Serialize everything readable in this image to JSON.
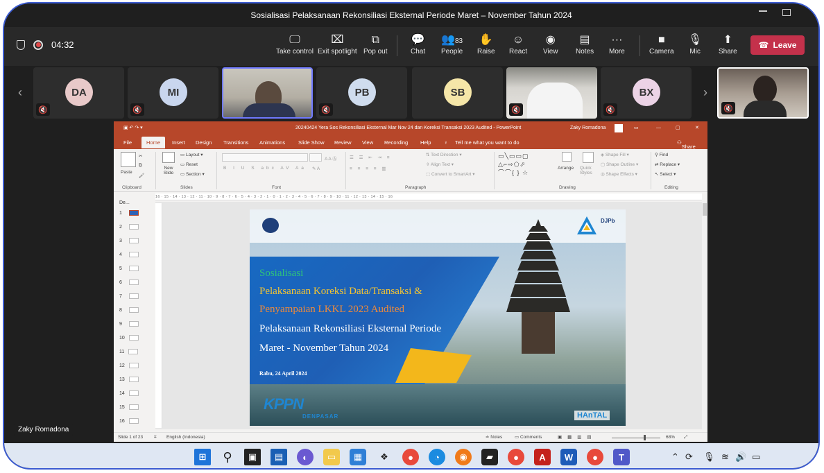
{
  "window": {
    "title": "Sosialisasi Pelaksanaan Rekonsiliasi Eksternal Periode Maret – November Tahun 2024"
  },
  "meeting": {
    "timer": "04:32",
    "people_count": "83"
  },
  "toolbar": {
    "take_control": "Take control",
    "exit_spotlight": "Exit spotlight",
    "pop_out": "Pop out",
    "chat": "Chat",
    "people": "People",
    "raise": "Raise",
    "react": "React",
    "view": "View",
    "notes": "Notes",
    "more": "More",
    "camera": "Camera",
    "mic": "Mic",
    "share": "Share",
    "leave": "Leave"
  },
  "participants": [
    {
      "initials": "DA",
      "color": "#e8c9c9"
    },
    {
      "initials": "MI",
      "color": "#c9d6ee"
    },
    {
      "initials": "",
      "color": ""
    },
    {
      "initials": "PB",
      "color": "#cfdcee"
    },
    {
      "initials": "SB",
      "color": "#f5e6a8"
    },
    {
      "initials": "",
      "color": ""
    },
    {
      "initials": "BX",
      "color": "#ecd3e6"
    }
  ],
  "ppt": {
    "title": "20240424 Yera Sos Rekonsiliasi Eksternal Mar Nov 24 dan Koreksi Transaksi 2023 Audited - PowerPoint",
    "user": "Zaky Romadona",
    "tabs": [
      "File",
      "Home",
      "Insert",
      "Design",
      "Transitions",
      "Animations",
      "Slide Show",
      "Review",
      "View",
      "Recording",
      "Help"
    ],
    "tell_me": "Tell me what you want to do",
    "share": "Share",
    "ribbon": {
      "paste": "Paste",
      "new_slide": "New Slide",
      "layout": "Layout",
      "reset": "Reset",
      "section": "Section",
      "text_direction": "Text Direction",
      "align_text": "Align Text",
      "convert_smartart": "Convert to SmartArt",
      "arrange": "Arrange",
      "quick_styles": "Quick Styles",
      "shape_fill": "Shape Fill",
      "shape_outline": "Shape Outline",
      "shape_effects": "Shape Effects",
      "find": "Find",
      "replace": "Replace",
      "select": "Select",
      "groups": [
        "Clipboard",
        "Slides",
        "Font",
        "Paragraph",
        "Drawing",
        "Editing"
      ]
    },
    "ruler": "16 · 15 · 14 · 13 · 12 · 11 · 10 · 9 · 8 · 7 · 6 · 5 · 4 · 3 · 2 · 1 · 0 · 1 · 2 · 3 · 4 · 5 · 6 · 7 · 8 · 9 · 10 · 11 · 12 · 13 · 14 · 15 · 16",
    "thumbs_label": "De...",
    "slide_numbers": [
      "1",
      "2",
      "3",
      "4",
      "5",
      "6",
      "7",
      "8",
      "9",
      "10",
      "11",
      "12",
      "13",
      "14",
      "15",
      "16"
    ],
    "status": {
      "slide_count": "Slide 1 of 23",
      "language": "English (Indonesia)",
      "notes": "Notes",
      "comments": "Comments",
      "zoom": "68%"
    }
  },
  "slide": {
    "line1": "Sosialisasi",
    "line2": "Pelaksanaan Koreksi Data/Transaksi &",
    "line3": "Penyampaian LKKL 2023 Audited",
    "line4": "Pelaksanaan Rekonsiliasi Eksternal Periode",
    "line5": "Maret - November Tahun 2024",
    "date": "Rabu, 24 April 2024",
    "logo_kppn": "KPPN",
    "logo_kppn_sub": "DENPASAR",
    "logo_djpb": "DJPb",
    "logo_hanal": "HAnTAL"
  },
  "nametag": "Zaky Romadona"
}
